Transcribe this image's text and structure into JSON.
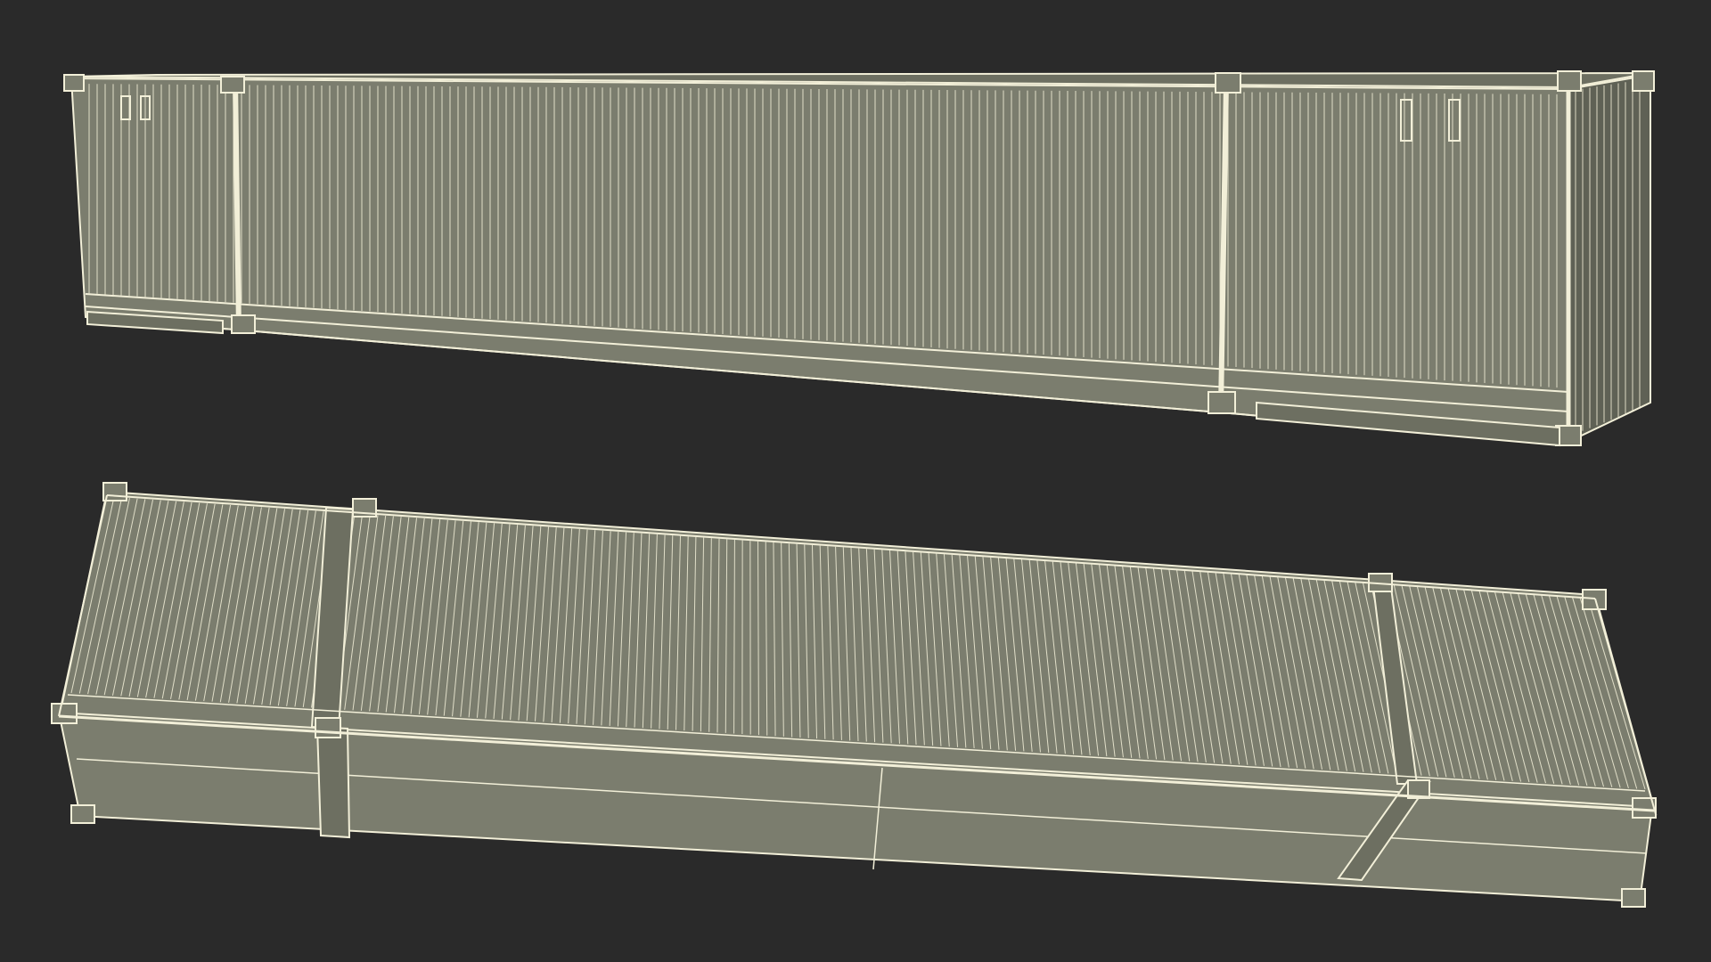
{
  "scene": {
    "background": "#2a2a2a",
    "wire_color": "#f2efd8",
    "panel_color": "#7b7d6e",
    "panel_shade": "#6d6f61",
    "panel_dark": "#5f6155",
    "objects": [
      "shipping-container-side-elevated",
      "shipping-container-top-down"
    ]
  }
}
